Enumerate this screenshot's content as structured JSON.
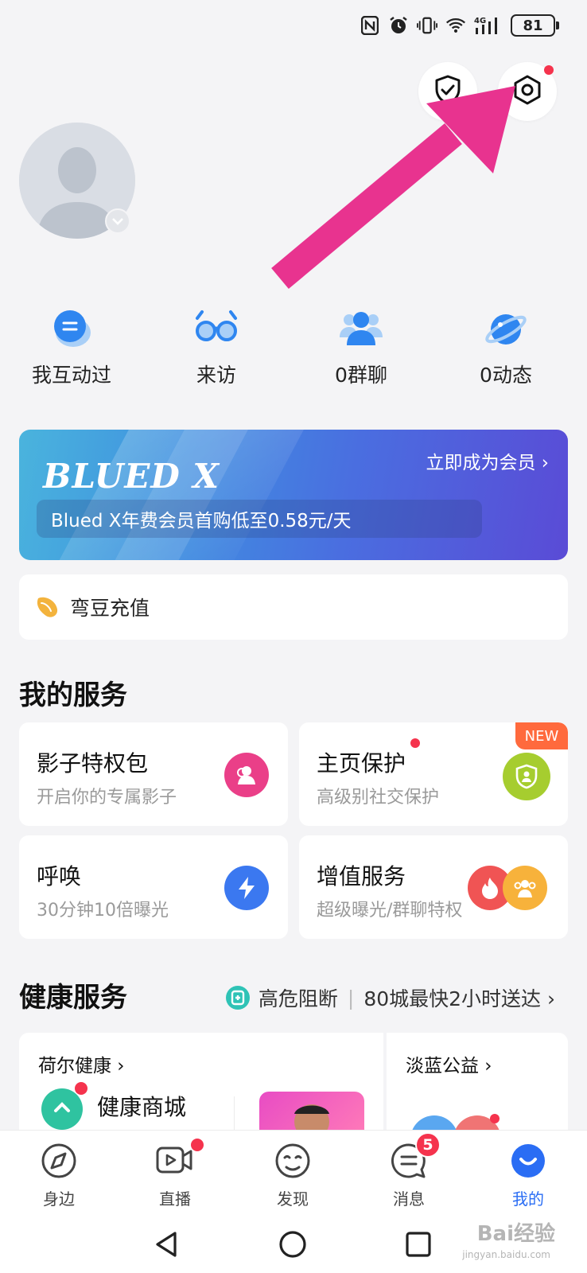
{
  "status_bar": {
    "battery": "81",
    "network": "4G"
  },
  "quick_actions": [
    {
      "label": "我互动过",
      "icon": "chat-bubble-icon"
    },
    {
      "label": "来访",
      "icon": "glasses-icon"
    },
    {
      "label": "0群聊",
      "icon": "group-icon"
    },
    {
      "label": "0动态",
      "icon": "planet-icon"
    }
  ],
  "banner": {
    "logo": "BLUED X",
    "cta": "立即成为会员 ›",
    "promo": "Blued X年费会员首购低至0.58元/天"
  },
  "recharge": {
    "label": "弯豆充值"
  },
  "my_services": {
    "title": "我的服务",
    "items": [
      {
        "title": "影子特权包",
        "subtitle": "开启你的专属影子"
      },
      {
        "title": "主页保护",
        "subtitle": "高级别社交保护",
        "badge": "NEW"
      },
      {
        "title": "呼唤",
        "subtitle": "30分钟10倍曝光"
      },
      {
        "title": "增值服务",
        "subtitle": "超级曝光/群聊特权"
      }
    ]
  },
  "health": {
    "title": "健康服务",
    "link_left": "高危阻断",
    "link_right": "80城最快2小时送达 ›",
    "card_left_title": "荷尔健康 ›",
    "card_left_item": "健康商城",
    "card_right_title": "淡蓝公益 ›"
  },
  "tabs": [
    {
      "label": "身边"
    },
    {
      "label": "直播"
    },
    {
      "label": "发现"
    },
    {
      "label": "消息",
      "badge": "5"
    },
    {
      "label": "我的"
    }
  ],
  "watermark": {
    "text": "Bai经验",
    "sub": "jingyan.baidu.com"
  },
  "colors": {
    "accent": "#2a6df4",
    "annotation_arrow": "#e8338f",
    "red_dot": "#f5334d"
  }
}
